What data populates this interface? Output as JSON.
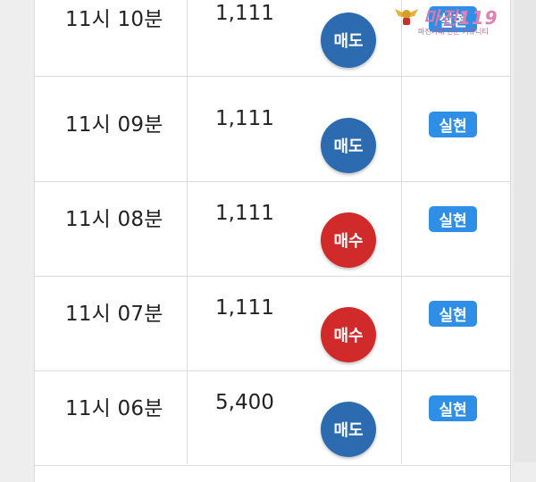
{
  "rows": [
    {
      "time": "11시 10분",
      "price": "1,111",
      "side": "매도",
      "side_type": "sell",
      "status": "실현"
    },
    {
      "time": "11시 09분",
      "price": "1,111",
      "side": "매도",
      "side_type": "sell",
      "status": "실현"
    },
    {
      "time": "11시 08분",
      "price": "1,111",
      "side": "매수",
      "side_type": "buy",
      "status": "실현"
    },
    {
      "time": "11시 07분",
      "price": "1,111",
      "side": "매수",
      "side_type": "buy",
      "status": "실현"
    },
    {
      "time": "11시 06분",
      "price": "5,400",
      "side": "매도",
      "side_type": "sell",
      "status": "실현"
    }
  ],
  "watermark": {
    "title": "마진",
    "title_suffix": "119",
    "subtitle": "마진거래 전문 커뮤니티"
  },
  "colors": {
    "sell": "#2d6bb0",
    "buy": "#d02a2a",
    "badge": "#2f8fe6"
  }
}
